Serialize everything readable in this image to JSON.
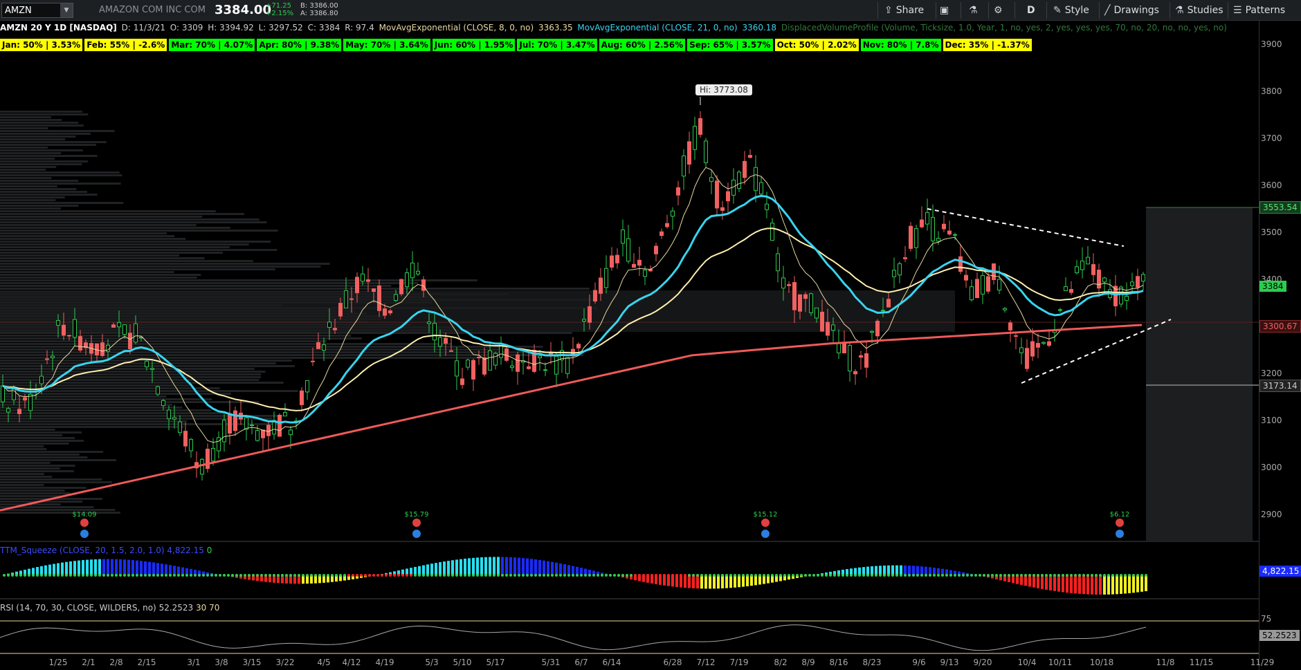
{
  "symbol": {
    "value": "AMZN"
  },
  "company": "AMAZON COM INC COM",
  "last": "3384.00",
  "change_abs": "+71.25",
  "change_pct": "+2.15%",
  "bid": "B: 3386.00",
  "ask": "A: 3386.80",
  "toolbar": {
    "share": "Share",
    "period": "D",
    "style": "Style",
    "drawings": "Drawings",
    "studies": "Studies",
    "patterns": "Patterns"
  },
  "info": {
    "title": "AMZN 20 Y 1D [NASDAQ]",
    "date": "D: 11/3/21",
    "open": "O: 3309",
    "high": "H: 3394.92",
    "low": "L: 3297.52",
    "close": "C: 3384",
    "range": "R: 97.4",
    "ema8_label": "MovAvgExponential (CLOSE, 8, 0, no)",
    "ema8_value": "3363.35",
    "ema21_label": "MovAvgExponential (CLOSE, 21, 0, no)",
    "ema21_value": "3360.18",
    "dvp_label": "DisplacedVolumeProfile (Volume, Ticksize, 1.0, Year, 1, no, yes, 2, yes, yes, yes, 70, no, 20, no, no, yes, no)"
  },
  "seasonality": [
    {
      "text": "Jan: 50% | 3.53%",
      "color": "#ffff00"
    },
    {
      "text": "Feb: 55% | -2.6%",
      "color": "#ffff00"
    },
    {
      "text": "Mar: 70% | 4.07%",
      "color": "#00ff00"
    },
    {
      "text": "Apr: 80% | 9.38%",
      "color": "#00ff00"
    },
    {
      "text": "May: 70% | 3.64%",
      "color": "#00ff00"
    },
    {
      "text": "Jun: 60% | 1.95%",
      "color": "#00ff00"
    },
    {
      "text": "Jul: 70% | 3.47%",
      "color": "#00ff00"
    },
    {
      "text": "Aug: 60% | 2.56%",
      "color": "#00ff00"
    },
    {
      "text": "Sep: 65% | 3.57%",
      "color": "#00ff00"
    },
    {
      "text": "Oct: 50% | 2.02%",
      "color": "#ffff00"
    },
    {
      "text": "Nov: 80% | 7.8%",
      "color": "#00ff00"
    },
    {
      "text": "Dec: 35% | -1.37%",
      "color": "#ffff00"
    }
  ],
  "price_axis": [
    "3900",
    "3800",
    "3700",
    "3600",
    "3500",
    "3400",
    "3300",
    "3200",
    "3100",
    "3000",
    "2900"
  ],
  "price_badges": {
    "upper": "3553.54",
    "last": "3384",
    "ema200": "3300.67",
    "lower": "3173.14"
  },
  "hi_label": "Hi: 3773.08",
  "dividends": [
    "$14.09",
    "$15.79",
    "$15.12",
    "$6.12"
  ],
  "squeeze": {
    "label": "TTM_Squeeze (CLOSE, 20, 1.5, 2.0, 1.0)",
    "value": "4,822.15",
    "zero": "0",
    "badge": "4,822.15"
  },
  "rsi": {
    "label": "RSI (14, 70, 30, CLOSE, WILDERS, no)",
    "value": "52.2523",
    "ob": "30",
    "os": "70",
    "axis": "75",
    "badge": "52.2523"
  },
  "time_axis": [
    "1/25",
    "2/1",
    "2/8",
    "2/15",
    "3/1",
    "3/8",
    "3/15",
    "3/22",
    "4/5",
    "4/12",
    "4/19",
    "5/3",
    "5/10",
    "5/17",
    "5/31",
    "6/7",
    "6/14",
    "6/28",
    "7/12",
    "7/19",
    "8/2",
    "8/9",
    "8/16",
    "8/23",
    "9/6",
    "9/13",
    "9/20",
    "10/4",
    "10/11",
    "10/18",
    "11/8",
    "11/15",
    "11/29"
  ],
  "colors": {
    "up": "#2dcc4f",
    "down": "#f26060",
    "ema8": "#e8d9a0",
    "ema21": "#38d4f0",
    "ema50": "#fff0b0",
    "ema200": "#f05a5a"
  }
}
